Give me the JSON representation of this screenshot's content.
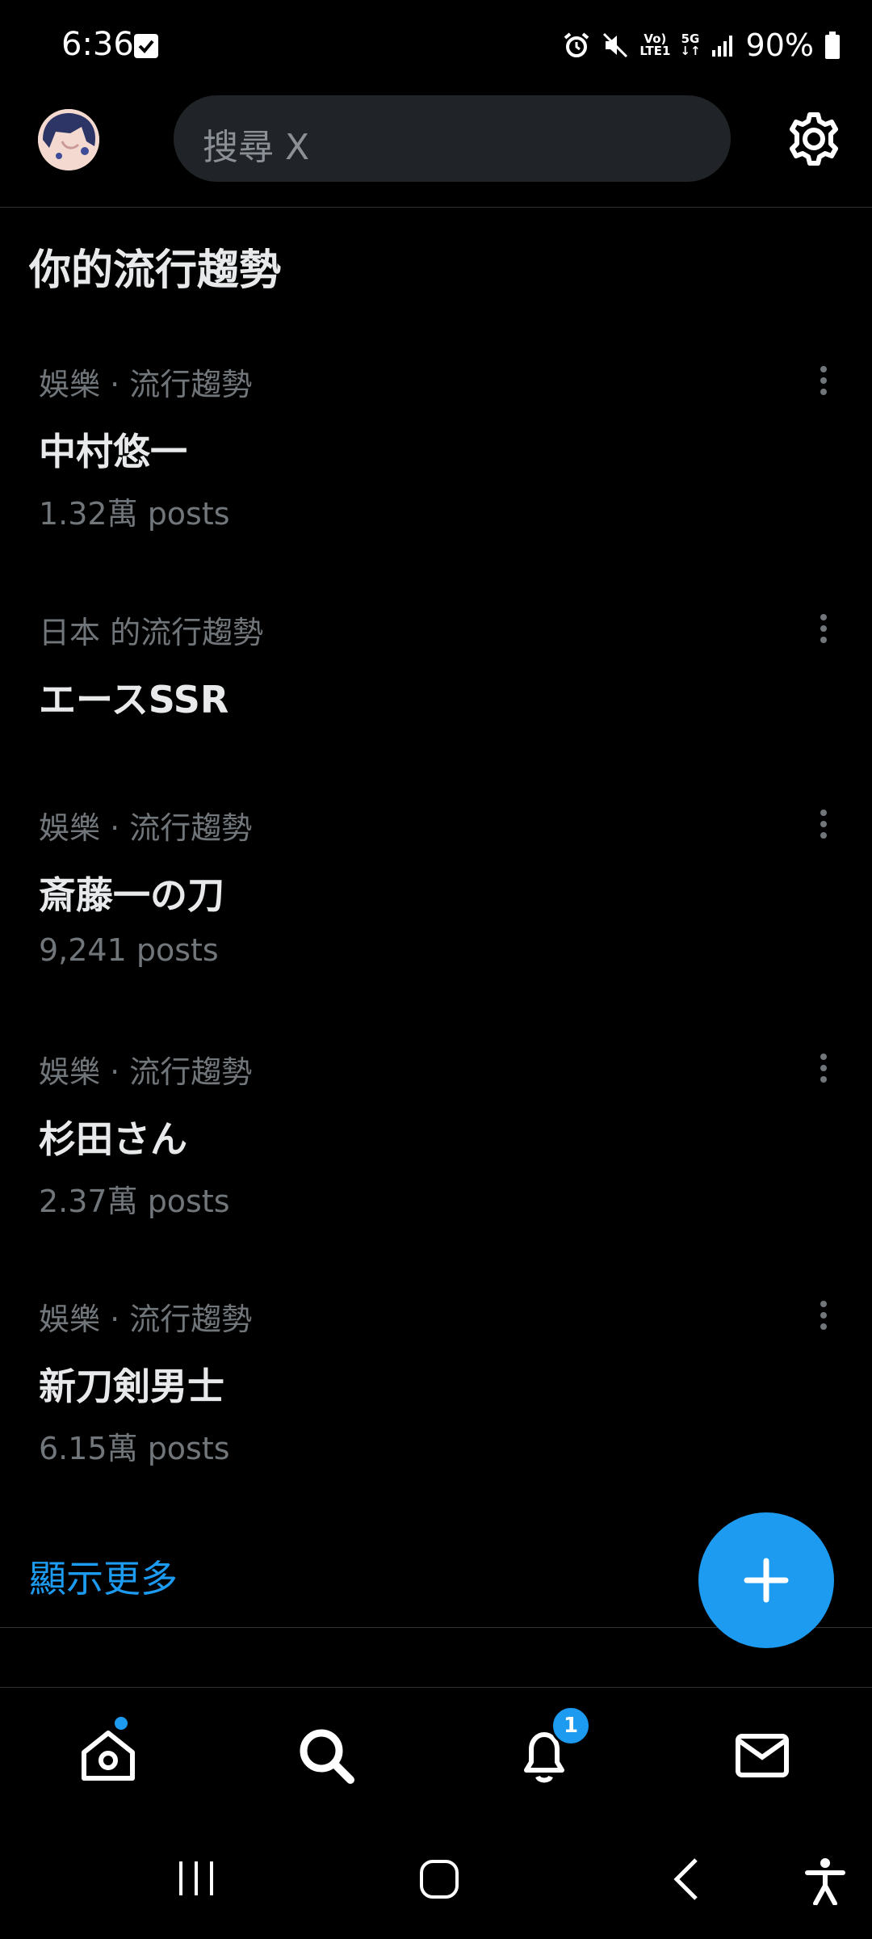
{
  "status_bar": {
    "time": "6:36",
    "network_top": "Vo)",
    "network_bottom": "LTE1",
    "net5g_top": "5G",
    "net5g_bottom": "↓↑",
    "battery": "90%"
  },
  "header": {
    "search_placeholder": "搜尋 X"
  },
  "section": {
    "title": "你的流行趨勢"
  },
  "trends": [
    {
      "meta": "娛樂 · 流行趨勢",
      "name": "中村悠一",
      "count": "1.32萬 posts"
    },
    {
      "meta": "日本 的流行趨勢",
      "name": "エースSSR",
      "count": ""
    },
    {
      "meta": "娛樂 · 流行趨勢",
      "name": "斎藤一の刀",
      "count": "9,241 posts"
    },
    {
      "meta": "娛樂 · 流行趨勢",
      "name": "杉田さん",
      "count": "2.37萬 posts"
    },
    {
      "meta": "娛樂 · 流行趨勢",
      "name": "新刀剣男士",
      "count": "6.15萬 posts"
    }
  ],
  "show_more": "顯示更多",
  "bottom_nav": {
    "notifications_badge": "1"
  },
  "colors": {
    "accent": "#1d9bf0",
    "background": "#000000",
    "secondary_text": "#71767b"
  },
  "icons": [
    "check-icon",
    "alarm-icon",
    "mute-icon",
    "signal-icon",
    "battery-icon",
    "avatar",
    "gear-icon",
    "more-icon",
    "plus-icon",
    "home-icon",
    "search-icon",
    "bell-icon",
    "mail-icon",
    "recents-icon",
    "home-circle-icon",
    "back-icon",
    "accessibility-icon"
  ]
}
